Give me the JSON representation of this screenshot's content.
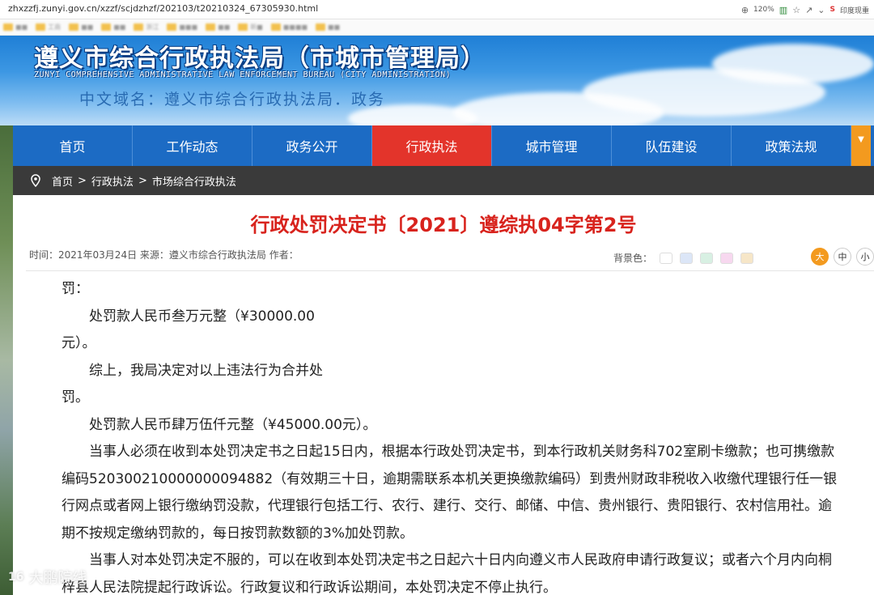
{
  "browser": {
    "url": "zhxzzfj.zunyi.gov.cn/xzzf/scjdzhzf/202103/t20210324_67305930.html",
    "zoom": "120%",
    "search_engine": "印度现重"
  },
  "bookmarks": [
    "■■",
    "工商",
    "■■",
    "■■",
    "浙江",
    "■■■",
    "■■",
    "新■",
    "■■■■",
    "■■"
  ],
  "banner": {
    "title": "遵义市综合行政执法局（市城市管理局）",
    "subtitle": "ZUNYI COMPREHENSIVE ADMINISTRATIVE LAW ENFORCEMENT BUREAU (CITY ADMINISTRATION)",
    "domain": "中文域名：遵义市综合行政执法局．政务"
  },
  "nav": {
    "items": [
      {
        "label": "首页"
      },
      {
        "label": "工作动态"
      },
      {
        "label": "政务公开"
      },
      {
        "label": "行政执法"
      },
      {
        "label": "城市管理"
      },
      {
        "label": "队伍建设"
      },
      {
        "label": "政策法规"
      }
    ],
    "active_index": 3
  },
  "breadcrumb": {
    "home": "首页",
    "sep": ">",
    "level1": "行政执法",
    "level2": "市场综合行政执法"
  },
  "article": {
    "title": "行政处罚决定书〔2021〕遵综执04字第2号",
    "meta": "时间：2021年03月24日  来源：遵义市综合行政执法局  作者：",
    "bgcolor_label": "背景色：",
    "bg_swatches": [
      "#ffffff",
      "#dce6f7",
      "#d8f0e3",
      "#f7d8ef",
      "#f6e6c8"
    ],
    "font_sizes": [
      "大",
      "中",
      "小"
    ],
    "paragraphs": [
      "罚：",
      "处罚款人民币叁万元整（¥30000.00",
      "元）。",
      "综上，我局决定对以上违法行为合并处",
      "罚。",
      "处罚款人民币肆万伍仟元整（¥45000.00元）。",
      "当事人必须在收到本处罚决定书之日起15日内，根据本行政处罚决定书，到本行政机关财务科702室刷卡缴款；也可携缴款编码520300210000000094882（有效期三十日，逾期需联系本机关更换缴款编码）到贵州财政非税收入收缴代理银行任一银行网点或者网上银行缴纳罚没款，代理银行包括工行、农行、建行、交行、邮储、中信、贵州银行、贵阳银行、农村信用社。逾期不按规定缴纳罚款的，每日按罚款数额的3%加处罚款。",
      "当事人对本处罚决定不服的，可以在收到本处罚决定书之日起六十日内向遵义市人民政府申请行政复议；或者六个月内向桐梓县人民法院提起行政诉讼。行政复议和行政诉讼期间，本处罚决定不停止执行。"
    ]
  },
  "watermark": {
    "logo": "16",
    "text": "大鹏院线"
  }
}
